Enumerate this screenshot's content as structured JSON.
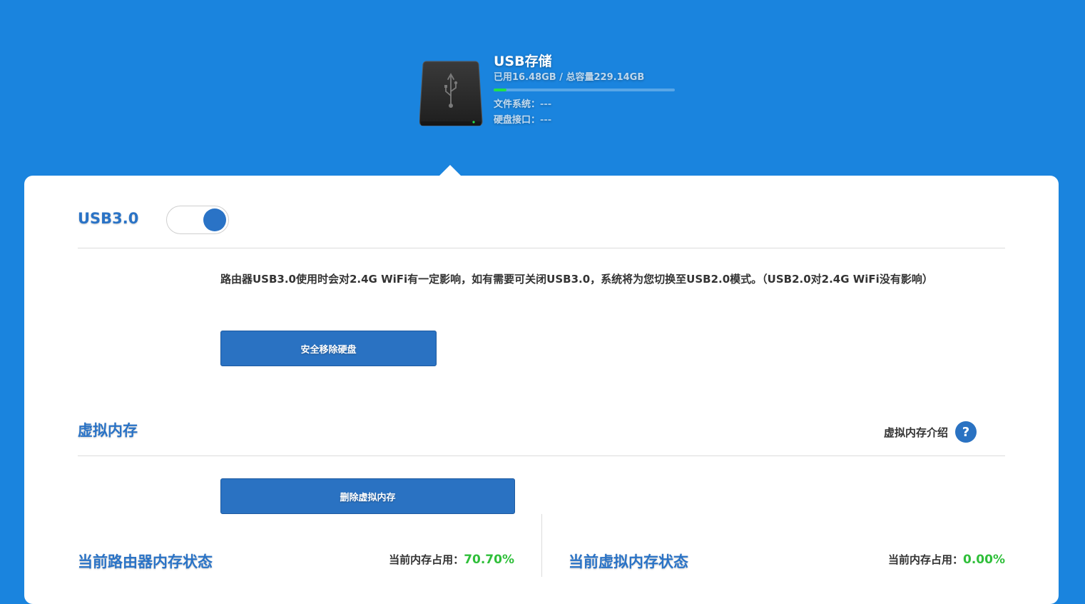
{
  "usb": {
    "title": "USB存储",
    "usage": "已用16.48GB / 总容量229.14GB",
    "usage_fraction": 0.072,
    "filesystem_label": "文件系统：",
    "filesystem_value": "---",
    "interface_label": "硬盘接口：",
    "interface_value": "---"
  },
  "usb3": {
    "title": "USB3.0",
    "enabled": true,
    "description": "路由器USB3.0使用时会对2.4G WiFi有一定影响，如有需要可关闭USB3.0，系统将为您切换至USB2.0模式。（USB2.0对2.4G WiFi没有影响）",
    "remove_button": "安全移除硬盘"
  },
  "virtual_memory": {
    "title": "虚拟内存",
    "intro_label": "虚拟内存介绍",
    "help_icon": "?",
    "delete_button": "删除虚拟内存"
  },
  "router_memory": {
    "title": "当前路由器内存状态",
    "usage_label": "当前内存占用：",
    "usage_value": "70.70%"
  },
  "virtual_memory_status": {
    "title": "当前虚拟内存状态",
    "usage_label": "当前内存占用：",
    "usage_value": "0.00%"
  },
  "colors": {
    "background": "#1a84de",
    "accent": "#2a73c6",
    "success": "#2fbf3a"
  }
}
